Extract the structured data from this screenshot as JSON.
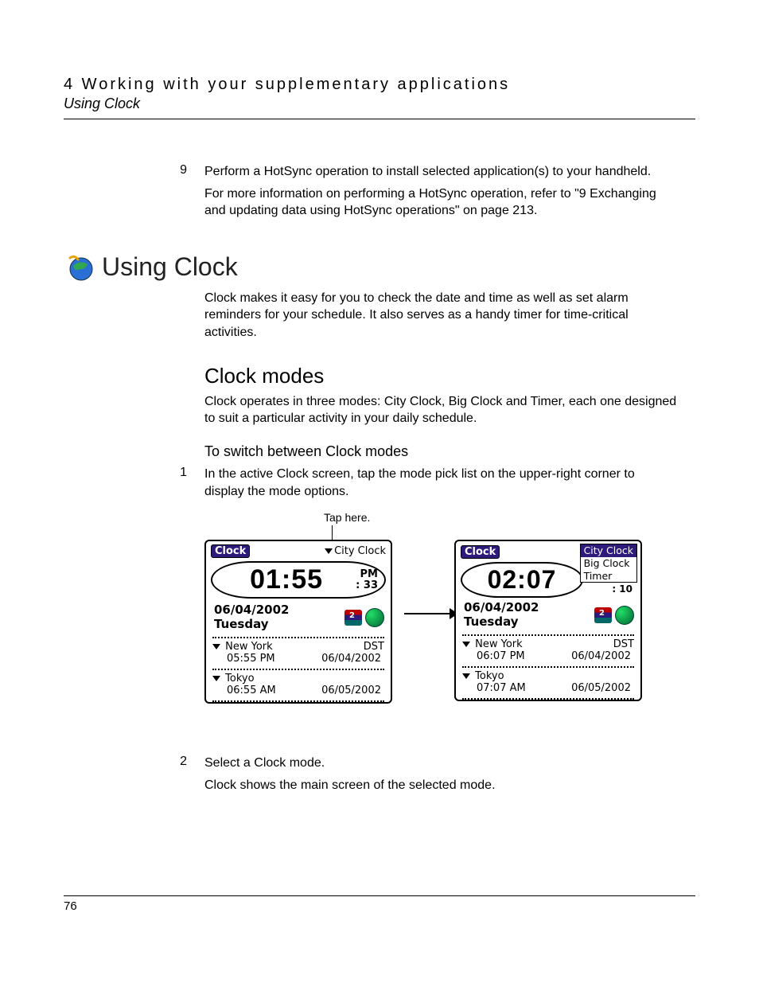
{
  "header": {
    "chapter": "4 Working with your supplementary applications",
    "subtitle": "Using Clock"
  },
  "step9": {
    "num": "9",
    "line1": "Perform a HotSync operation to install selected application(s) to your handheld.",
    "line2": "For more information on performing a HotSync operation, refer to \"9 Exchanging and updating data using HotSync operations\" on page 213."
  },
  "section": {
    "title": "Using Clock",
    "intro": "Clock makes it easy for you to check the date and time as well as set alarm reminders for your schedule. It also serves as a handy timer for time-critical activities."
  },
  "modes": {
    "title": "Clock modes",
    "intro": "Clock operates in three modes: City Clock, Big Clock and Timer, each one designed to suit a particular activity in your daily schedule.",
    "switch_title": "To switch between Clock modes",
    "step1_num": "1",
    "step1": "In the active Clock screen, tap the mode pick list on the upper-right corner to display the mode options.",
    "tap_label": "Tap here.",
    "step2_num": "2",
    "step2_a": "Select a Clock mode.",
    "step2_b": "Clock shows the main screen of the selected mode."
  },
  "pda_left": {
    "app": "Clock",
    "mode": "City Clock",
    "time": "01:55",
    "ampm": "PM",
    "secs": ": 33",
    "date": "06/04/2002",
    "dow": "Tuesday",
    "city1": {
      "name": "New York",
      "dst": "DST",
      "time": "05:55 PM",
      "date": "06/04/2002"
    },
    "city2": {
      "name": "Tokyo",
      "time": "06:55 AM",
      "date": "06/05/2002"
    }
  },
  "pda_right": {
    "app": "Clock",
    "menu": [
      "City Clock",
      "Big Clock",
      "Timer"
    ],
    "time": "02:07",
    "secs": ": 10",
    "date": "06/04/2002",
    "dow": "Tuesday",
    "city1": {
      "name": "New York",
      "dst": "DST",
      "time": "06:07 PM",
      "date": "06/04/2002"
    },
    "city2": {
      "name": "Tokyo",
      "time": "07:07 AM",
      "date": "06/05/2002"
    }
  },
  "page_number": "76"
}
